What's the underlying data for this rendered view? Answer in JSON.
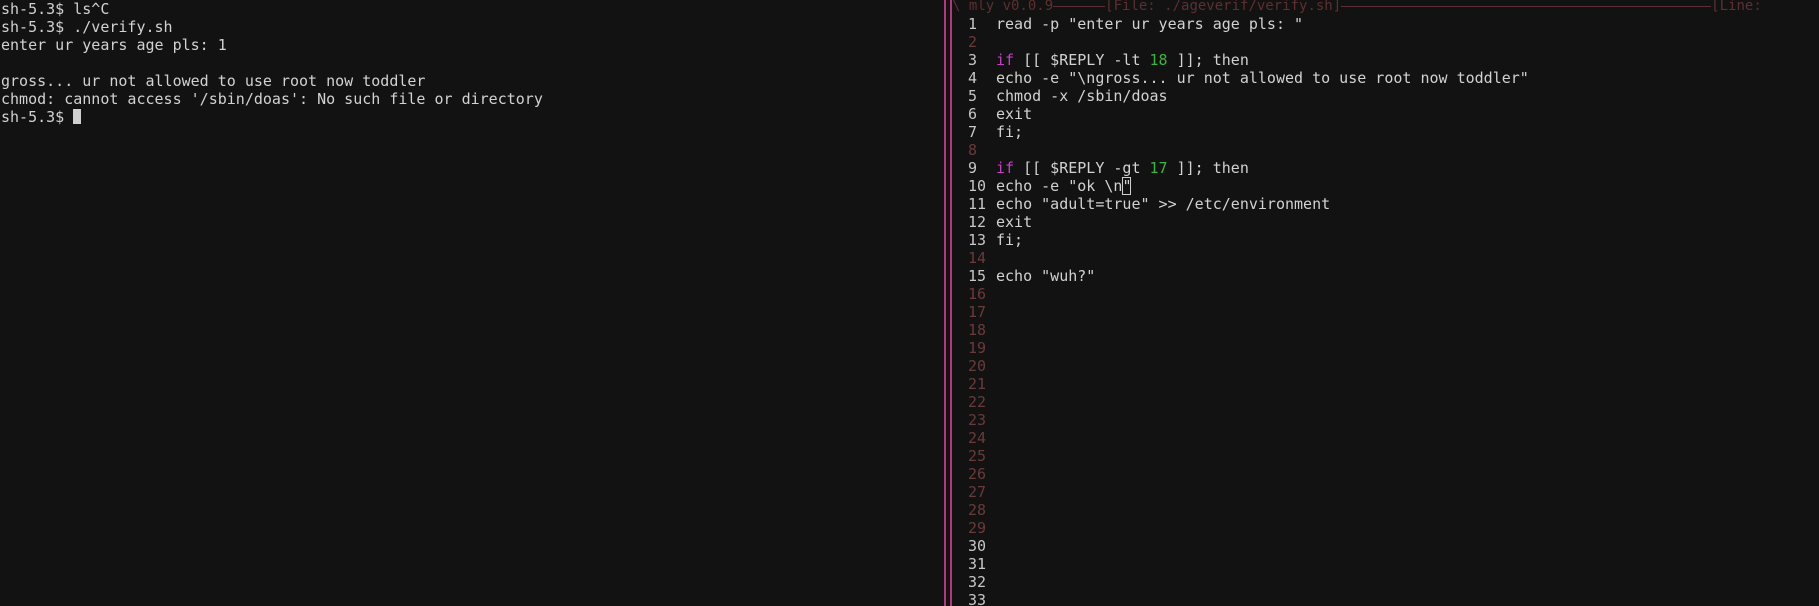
{
  "terminal": {
    "lines": [
      "sh-5.3$ ls^C",
      "sh-5.3$ ./verify.sh",
      "enter ur years age pls: 1",
      "",
      "gross... ur not allowed to use root now toddler",
      "chmod: cannot access '/sbin/doas': No such file or directory"
    ],
    "prompt": "sh-5.3$ "
  },
  "editor": {
    "header_app": "\\ mly v0.0.9",
    "header_file": "[File: ./ageverif/verify.sh]",
    "header_line": "[Line:",
    "code": [
      {
        "n": "1",
        "parts": [
          {
            "t": "read -p \"enter ur years age pls: \""
          }
        ]
      },
      {
        "n": "2",
        "parts": []
      },
      {
        "n": "3",
        "parts": [
          {
            "t": "if",
            "c": "kw"
          },
          {
            "t": " [[ $REPLY -lt "
          },
          {
            "t": "18",
            "c": "num"
          },
          {
            "t": " ]]; then"
          }
        ]
      },
      {
        "n": "4",
        "parts": [
          {
            "t": "echo -e \"\\ngross... ur not allowed to use root now toddler\""
          }
        ]
      },
      {
        "n": "5",
        "parts": [
          {
            "t": "chmod -x /sbin/doas"
          }
        ]
      },
      {
        "n": "6",
        "parts": [
          {
            "t": "exit"
          }
        ]
      },
      {
        "n": "7",
        "parts": [
          {
            "t": "fi;"
          }
        ]
      },
      {
        "n": "8",
        "parts": []
      },
      {
        "n": "9",
        "parts": [
          {
            "t": "if",
            "c": "kw"
          },
          {
            "t": " [[ $REPLY -gt "
          },
          {
            "t": "17",
            "c": "num"
          },
          {
            "t": " ]]; then"
          }
        ]
      },
      {
        "n": "10",
        "parts": [
          {
            "t": "echo -e \"ok \\n"
          },
          {
            "t": "\"",
            "c": "edit-cursor"
          }
        ]
      },
      {
        "n": "11",
        "parts": [
          {
            "t": "echo \"adult=true\" >> /etc/environment"
          }
        ]
      },
      {
        "n": "12",
        "parts": [
          {
            "t": "exit"
          }
        ]
      },
      {
        "n": "13",
        "parts": [
          {
            "t": "fi;"
          }
        ]
      },
      {
        "n": "14",
        "parts": []
      },
      {
        "n": "15",
        "parts": [
          {
            "t": "echo \"wuh?\""
          }
        ]
      }
    ],
    "empty_lines": [
      "16",
      "17",
      "18",
      "19",
      "20",
      "21",
      "22",
      "23",
      "24",
      "25",
      "26",
      "27",
      "28",
      "29",
      "30",
      "31",
      "32",
      "33"
    ]
  }
}
